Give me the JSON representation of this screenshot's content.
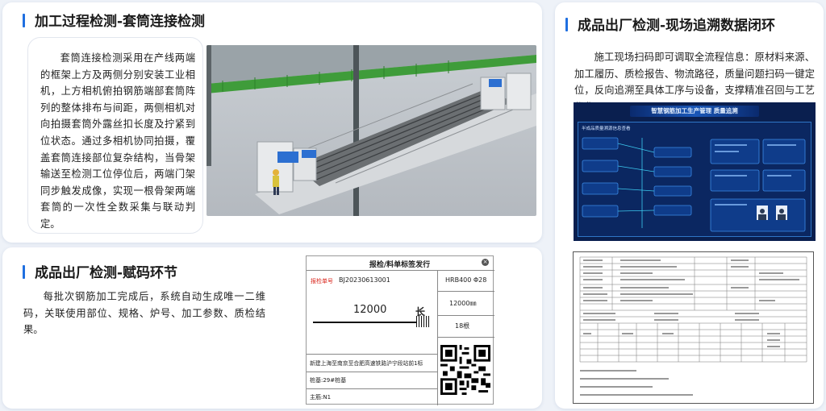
{
  "sections": {
    "sleeve": {
      "title": "加工过程检测-套筒连接检测",
      "body": "套筒连接检测采用在产线两端的框架上方及两侧分别安装工业相机，上方相机俯拍钢筋端部套筒阵列的整体排布与间距，两侧相机对向拍摄套筒外露丝扣长度及拧紧到位状态。通过多相机协同拍摄，覆盖套筒连接部位复杂结构，当骨架输送至检测工位停位后，两端门架同步触发成像，实现一根骨架两端套筒的一次性全数采集与联动判定。",
      "image_alt": "产线套筒检测工位"
    },
    "coding": {
      "title": "成品出厂检测-赋码环节",
      "body": "每批次钢筋加工完成后，系统自动生成唯一二维码，关联使用部位、规格、炉号、加工参数、质检结果。"
    },
    "trace": {
      "title": "成品出厂检测-现场追溯数据闭环",
      "body": "施工现场扫码即可调取全流程信息：原材料来源、加工履历、质检报告、物流路径，质量问题扫码一键定位，反向追溯至具体工序与设备，支撑精准召回与工艺优化"
    }
  },
  "label_card": {
    "header": "报检/料单标签发行",
    "code_label": "报检单号",
    "code": "BJ20230613001",
    "spec": "HRB400 Φ28",
    "length_value": "12000",
    "length_mark": "长",
    "length_mm": "12000㎜",
    "count": "18根",
    "project": "新建上海至南京至合肥高速铁路沪宁段站前1标",
    "pile": "桩基:29#桩基",
    "main_bar": "主筋:N1"
  },
  "dashboard": {
    "title": "智慧钢筋加工生产管理 质量追溯",
    "panel_title": "半成品质量溯源信息查看"
  },
  "colors": {
    "accent": "#1f6fe0",
    "label_red": "#d9261c",
    "dashboard_bg": "#0a1f4f"
  }
}
